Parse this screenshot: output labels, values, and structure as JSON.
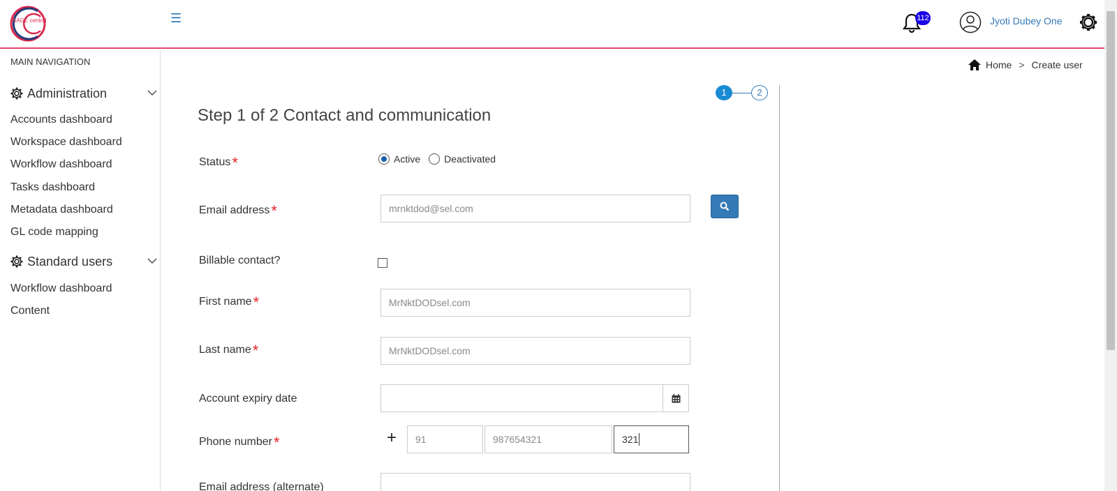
{
  "header": {
    "logo_text": "SAGE central",
    "notification_count": "112",
    "user_name": "Jyoti Dubey One",
    "brand_color": "#e8426a",
    "accent_color": "#337ab7",
    "badge_color": "#1900e6"
  },
  "sidebar": {
    "heading": "MAIN NAVIGATION",
    "groups": [
      {
        "label": "Administration",
        "icon": "gear-icon",
        "items": [
          "Accounts dashboard",
          "Workspace dashboard",
          "Workflow dashboard",
          "Tasks dashboard",
          "Metadata dashboard",
          "GL code mapping"
        ]
      },
      {
        "label": "Standard users",
        "icon": "gear-icon",
        "items": [
          "Workflow dashboard",
          "Content"
        ]
      }
    ]
  },
  "breadcrumb": {
    "home": "Home",
    "separator": ">",
    "current": "Create user"
  },
  "stepper": {
    "step1": "1",
    "step2": "2",
    "current_step": 1
  },
  "form": {
    "title": "Step 1 of 2 Contact and communication",
    "required_mark": "*",
    "status": {
      "label": "Status",
      "options": [
        "Active",
        "Deactivated"
      ],
      "selected": "Active"
    },
    "email": {
      "label": "Email address",
      "value": "mrnktdod@sel.com"
    },
    "billable": {
      "label": "Billable contact?",
      "checked": false
    },
    "first_name": {
      "label": "First name",
      "value": "MrNktDODsel.com"
    },
    "last_name": {
      "label": "Last name",
      "value": "MrNktDODsel.com"
    },
    "expiry": {
      "label": "Account expiry date",
      "value": ""
    },
    "phone": {
      "label": "Phone number",
      "plus": "+",
      "country_code": "91",
      "number": "987654321",
      "extension": "321"
    },
    "alt_email": {
      "label": "Email address (alternate)",
      "value": ""
    }
  }
}
